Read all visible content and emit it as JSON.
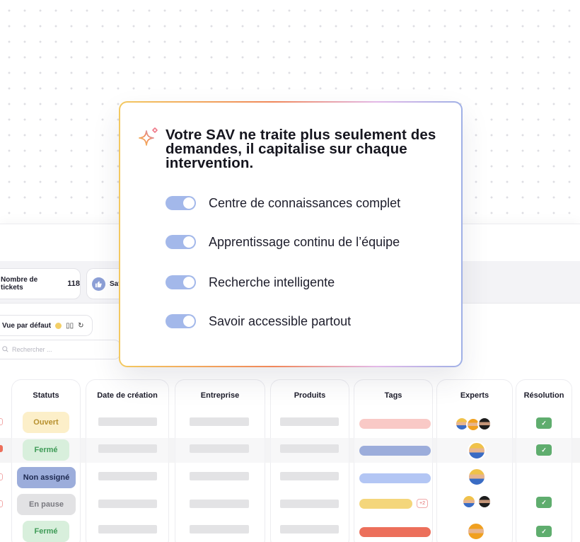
{
  "modal": {
    "title": "Votre SAV ne traite plus seulement des demandes, il capitalise sur chaque intervention.",
    "icon": "sparkle-icon",
    "features": [
      {
        "label": "Centre de connaissances complet",
        "enabled": true
      },
      {
        "label": "Apprentissage continu de l’équipe",
        "enabled": true
      },
      {
        "label": "Recherche intelligente",
        "enabled": true
      },
      {
        "label": "Savoir accessible partout",
        "enabled": true
      }
    ],
    "colors": {
      "toggle": "#a3b8ea",
      "gradient": [
        "#f3c960",
        "#f0875a",
        "#e3b9e8",
        "#9fb0e6"
      ]
    }
  },
  "dashboard": {
    "kpis": [
      {
        "label": "Nombre de tickets",
        "value": "118"
      },
      {
        "label": "Sat",
        "icon": "thumbs-up-icon"
      }
    ],
    "view": {
      "label": "Vue par défaut",
      "icons": [
        "columns-icon",
        "refresh-icon"
      ]
    },
    "search": {
      "placeholder": "Rechercher ..."
    },
    "columns": [
      "Statuts",
      "Date de création",
      "Entreprise",
      "Produits",
      "Tags",
      "Experts",
      "Résolution"
    ],
    "rows": [
      {
        "status": "Ouvert",
        "status_color": "#fcefc9",
        "status_text_color": "#b7902e",
        "tag_color": "#f9c9c6",
        "resolved": true
      },
      {
        "status": "Fermé",
        "status_color": "#d8efdc",
        "status_text_color": "#3f9b57",
        "tag_color": "#9caddb",
        "resolved": true
      },
      {
        "status": "Non assigné",
        "status_color": "#9caddb",
        "status_text_color": "#1d2950",
        "tag_color": "#b3c6f4",
        "resolved": false
      },
      {
        "status": "En pause",
        "status_color": "#e2e2e4",
        "status_text_color": "#7a7a80",
        "tag_color": "#f4d67b",
        "tag_more": "+2",
        "resolved": true
      },
      {
        "status": "Fermé",
        "status_color": "#d8efdc",
        "status_text_color": "#3f9b57",
        "tag_color": "#ec6f5b",
        "resolved": true
      }
    ]
  }
}
